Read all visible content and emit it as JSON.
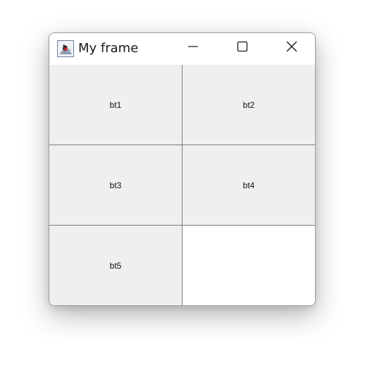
{
  "window": {
    "title": "My frame",
    "icon": "java-duke-icon"
  },
  "title_controls": {
    "minimize_icon": "minimize-icon",
    "maximize_icon": "maximize-icon",
    "close_icon": "close-icon"
  },
  "buttons": [
    {
      "label": "bt1"
    },
    {
      "label": "bt2"
    },
    {
      "label": "bt3"
    },
    {
      "label": "bt4"
    },
    {
      "label": "bt5"
    }
  ]
}
